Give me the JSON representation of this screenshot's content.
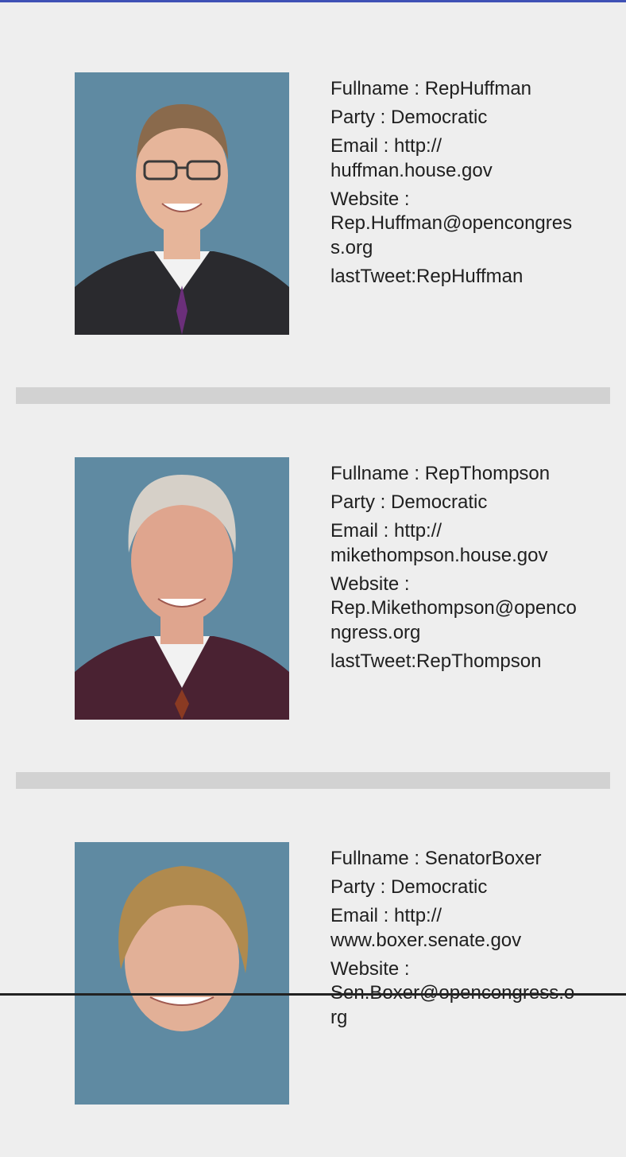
{
  "members": [
    {
      "fullname_label": "Fullname : RepHuffman",
      "party_label": "Party : Democratic",
      "email_label": "Email : http://",
      "email_value": "huffman.house.gov",
      "website_label": "Website :",
      "website_value": "Rep.Huffman@opencongress.org",
      "last_tweet_label": "lastTweet:RepHuffman",
      "photo": {
        "hair": "#8a6a4c",
        "skin": "#e6b59a",
        "suit": "#2a2a2e",
        "tie": "#6b2f7a",
        "glasses": true
      }
    },
    {
      "fullname_label": "Fullname : RepThompson",
      "party_label": "Party : Democratic",
      "email_label": "Email : http://",
      "email_value": "mikethompson.house.gov",
      "website_label": "Website :",
      "website_value": "Rep.Mikethompson@opencongress.org",
      "last_tweet_label": "lastTweet:RepThompson",
      "photo": {
        "hair": "#d6d0c8",
        "skin": "#dfa58e",
        "suit": "#4a2232",
        "tie": "#8a3a22",
        "glasses": false
      }
    },
    {
      "fullname_label": "Fullname : SenatorBoxer",
      "party_label": "Party : Democratic",
      "email_label": "Email : http://",
      "email_value": "www.boxer.senate.gov",
      "website_label": "Website :",
      "website_value": "Sen.Boxer@opencongress.org",
      "last_tweet_label": "",
      "photo": {
        "hair": "#b08a4e",
        "skin": "#e2b097",
        "suit": "#2a2a2e",
        "tie": "",
        "glasses": false
      }
    }
  ],
  "colors": {
    "background": "#eeeeee",
    "divider": "#d2d2d2",
    "accent": "#3f51b5",
    "text": "#1f1f1f",
    "photo_backdrop": "#5f8aa2"
  }
}
